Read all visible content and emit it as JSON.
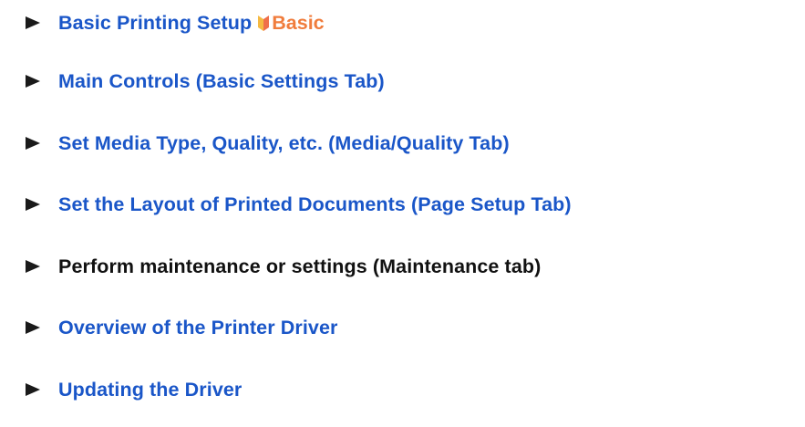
{
  "items": [
    {
      "label": "Basic Printing Setup",
      "link": true,
      "badge": "Basic"
    },
    {
      "label": "Main Controls (Basic Settings Tab)",
      "link": true
    },
    {
      "label": "Set Media Type, Quality, etc. (Media/Quality Tab)",
      "link": true
    },
    {
      "label": "Set the Layout of Printed Documents (Page Setup Tab)",
      "link": true
    },
    {
      "label": "Perform maintenance or settings (Maintenance tab)",
      "link": false
    },
    {
      "label": "Overview of the Printer Driver",
      "link": true
    },
    {
      "label": "Updating the Driver",
      "link": true
    }
  ],
  "icons": {
    "bullet": "arrow-bullet-icon",
    "badge": "basic-leaf-icon"
  },
  "colors": {
    "link": "#1a56c8",
    "plain": "#111111",
    "badge": "#f07c3c",
    "bullet": "#1a1a1a"
  }
}
